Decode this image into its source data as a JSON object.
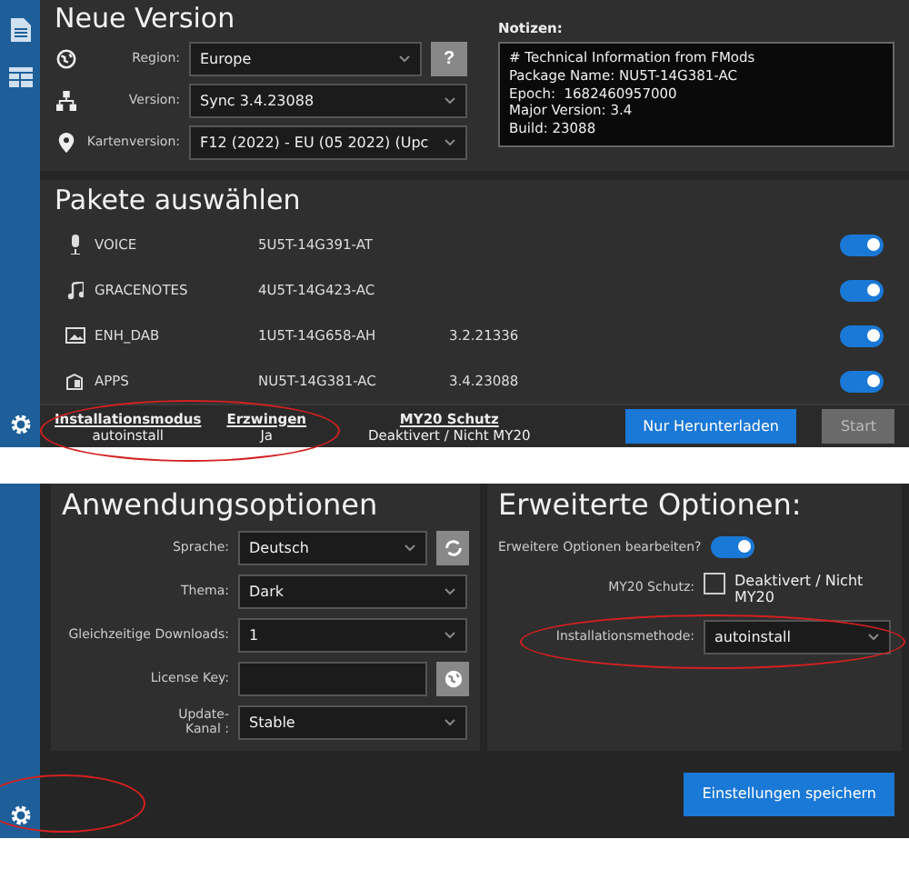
{
  "top_screen": {
    "new_version": {
      "title": "Neue Version",
      "fields": [
        {
          "label": "Region:",
          "value": "Europe",
          "help": "?"
        },
        {
          "label": "Version:",
          "value": "Sync 3.4.23088"
        },
        {
          "label": "Kartenversion:",
          "value": "F12 (2022) - EU (05 2022) (Upc"
        }
      ]
    },
    "notes": {
      "label": "Notizen:",
      "lines": [
        "# Technical Information from FMods",
        "Package Name: NU5T-14G381-AC",
        "Epoch:  1682460957000",
        "Major Version: 3.4",
        "Build: 23088"
      ]
    },
    "packages": {
      "title": "Pakete auswählen",
      "rows": [
        {
          "name": "VOICE",
          "part": "5U5T-14G391-AT",
          "on": true
        },
        {
          "name": "GRACENOTES",
          "part": "4U5T-14G423-AC",
          "on": true
        },
        {
          "name": "ENH_DAB",
          "part": "1U5T-14G658-AH",
          "version": "3.2.21336",
          "on": true
        },
        {
          "name": "APPS",
          "part": "NU5T-14G381-AC",
          "version": "3.4.23088",
          "on": true
        }
      ]
    },
    "status": [
      {
        "heading": "Installationsmodus",
        "value": "autoinstall"
      },
      {
        "heading": "Erzwingen",
        "value": "Ja"
      },
      {
        "heading": "MY20 Schutz",
        "value": "Deaktivert / Nicht MY20"
      }
    ],
    "buttons": [
      {
        "label": "Nur Herunterladen",
        "disabled": false
      },
      {
        "label": "Start",
        "disabled": true
      }
    ]
  },
  "bottom_screen": {
    "app_options": {
      "title": "Anwendungsoptionen",
      "fields": [
        {
          "kind": "select",
          "label": "Sprache:",
          "value": "Deutsch",
          "has_button": true
        },
        {
          "kind": "select",
          "label": "Thema:",
          "value": "Dark",
          "has_button": false
        },
        {
          "kind": "select",
          "label": "Gleichzeitige Downloads:",
          "value": "1",
          "has_button": false
        },
        {
          "kind": "input",
          "label": "License Key:",
          "has_button": true
        },
        {
          "kind": "select",
          "label": "Update-Kanal :",
          "value": "Stable",
          "has_button": false
        }
      ]
    },
    "advanced": {
      "title": "Erweiterte Optionen:",
      "toggle": {
        "label": "Erweitere Optionen bearbeiten?",
        "on": true
      },
      "protection": {
        "label": "MY20 Schutz:",
        "text": "Deaktivert / Nicht MY20",
        "checked": false
      },
      "method": {
        "label": "Installationsmethode:",
        "value": "autoinstall"
      }
    },
    "save_button": "Einstellungen speichern"
  }
}
